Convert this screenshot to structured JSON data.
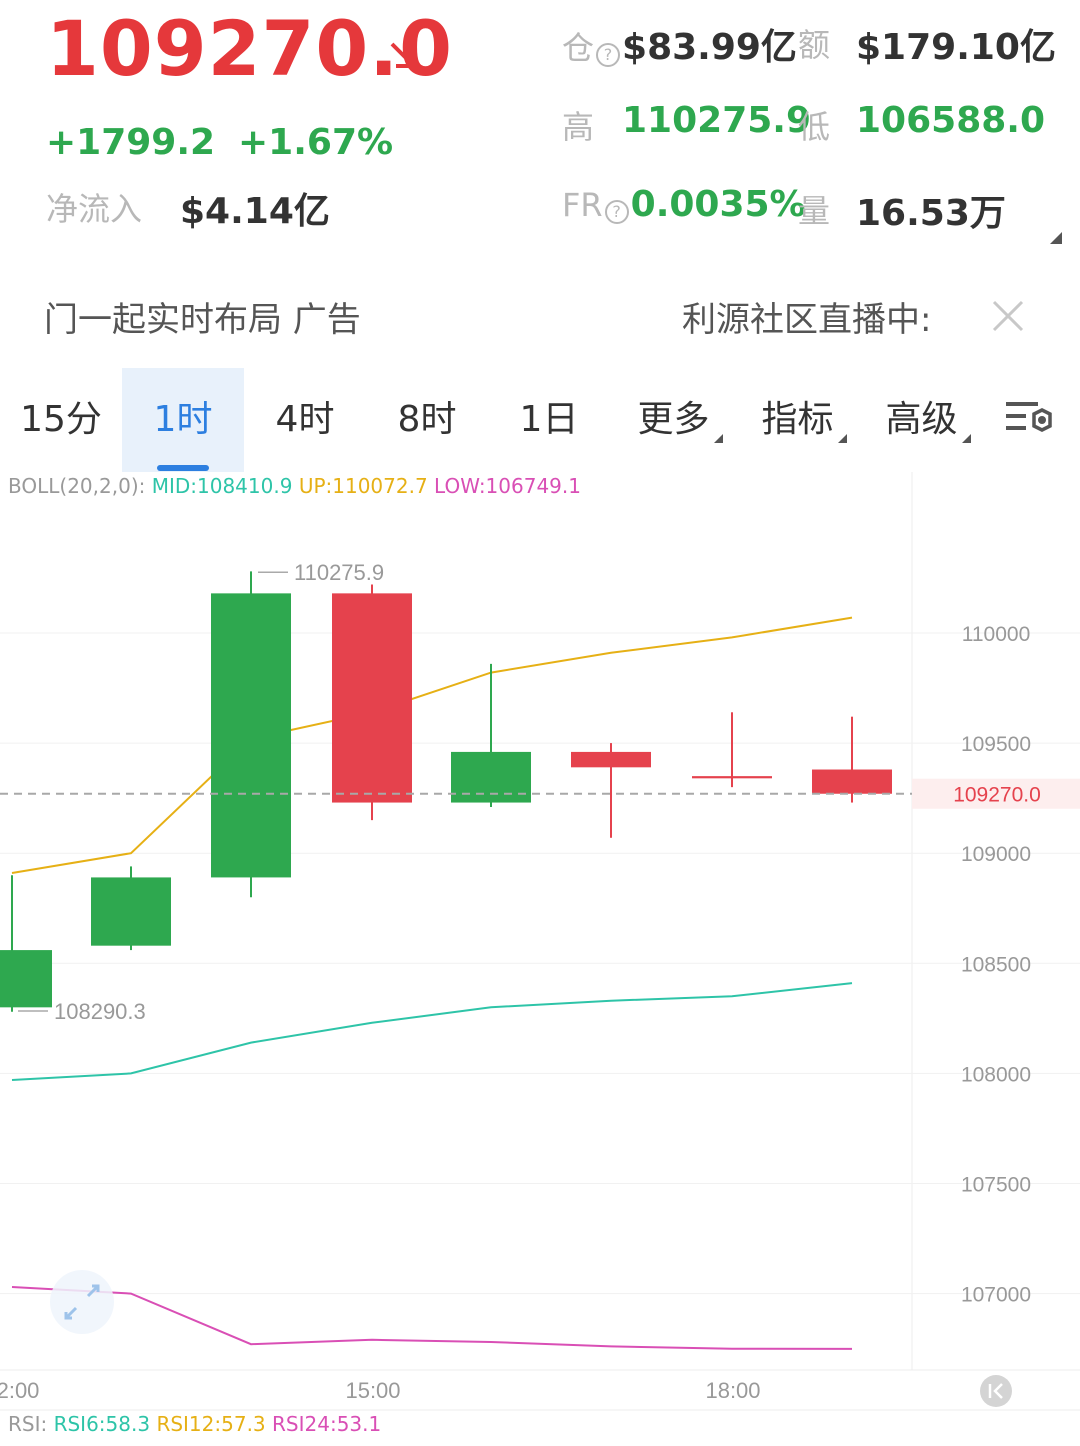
{
  "header": {
    "price": "109270.0",
    "change": "+1799.2",
    "change_pct": "+1.67%",
    "net_inflow_label": "净流入",
    "net_inflow_value": "$4.14亿",
    "oi_label": "仓",
    "oi_value": "$83.99亿",
    "amount_label": "额",
    "amount_value": "$179.10亿",
    "high_label": "高",
    "high_value": "110275.9",
    "low_label": "低",
    "low_value": "106588.0",
    "fr_label": "FR",
    "fr_value": "0.0035%",
    "volume_label": "量",
    "volume_value": "16.53万",
    "info_glyph": "?"
  },
  "banner": {
    "left_text": "门一起实时布局  广告",
    "right_text": "利源社区直播中:"
  },
  "tabs": [
    {
      "label": "15分"
    },
    {
      "label": "1时"
    },
    {
      "label": "4时"
    },
    {
      "label": "8时"
    },
    {
      "label": "1日"
    },
    {
      "label": "更多"
    },
    {
      "label": "指标"
    },
    {
      "label": "高级"
    }
  ],
  "boll": {
    "prefix": "BOLL(20,2,0):",
    "mid": "MID:108410.9",
    "up": "UP:110072.7",
    "low": "LOW:106749.1"
  },
  "rsi": {
    "prefix": "RSI:",
    "rsi6": "RSI6:58.3",
    "rsi12": "RSI12:57.3",
    "rsi24": "RSI24:53.1"
  },
  "colors": {
    "up": "#2ea84f",
    "down": "#e5424d",
    "price_red": "#e5383b",
    "boll_mid": "#2ec4a8",
    "boll_up": "#e6b015",
    "boll_low": "#d94fb5",
    "accent": "#2d7fe0"
  },
  "chart_data": {
    "type": "candlestick",
    "yticks": [
      110000,
      109500,
      109000,
      108500,
      108000,
      107500,
      107000
    ],
    "ytick_labels": [
      "110000",
      "109500",
      "109000",
      "108500",
      "108000",
      "107500",
      "107000"
    ],
    "current_price": 109270.0,
    "current_price_label": "109270.0",
    "xtick_labels": [
      "2:00",
      "15:00",
      "18:00"
    ],
    "high_marker": {
      "value": 110275.9,
      "label": "110275.9"
    },
    "low_marker": {
      "value": 108290.3,
      "label": "108290.3"
    },
    "candles": [
      {
        "open": 108560,
        "close": 108300,
        "high": 108900,
        "low": 108280,
        "dir": "up"
      },
      {
        "open": 108580,
        "close": 108890,
        "high": 108940,
        "low": 108560,
        "dir": "up"
      },
      {
        "open": 108890,
        "close": 110180,
        "high": 110280,
        "low": 108800,
        "dir": "up"
      },
      {
        "open": 110180,
        "close": 109230,
        "high": 110220,
        "low": 109150,
        "dir": "down"
      },
      {
        "open": 109230,
        "close": 109460,
        "high": 109860,
        "low": 109210,
        "dir": "up"
      },
      {
        "open": 109460,
        "close": 109390,
        "high": 109500,
        "low": 109070,
        "dir": "down"
      },
      {
        "open": 109350,
        "close": 109340,
        "high": 109640,
        "low": 109300,
        "dir": "down"
      },
      {
        "open": 109380,
        "close": 109270,
        "high": 109620,
        "low": 109230,
        "dir": "down"
      }
    ],
    "boll_up_line": [
      108910,
      109000,
      109520,
      109640,
      109820,
      109910,
      109980,
      110070
    ],
    "boll_mid_line": [
      107970,
      108000,
      108140,
      108230,
      108300,
      108330,
      108350,
      108410
    ],
    "boll_low_line": [
      107030,
      107000,
      106770,
      106790,
      106780,
      106760,
      106750,
      106749
    ]
  }
}
